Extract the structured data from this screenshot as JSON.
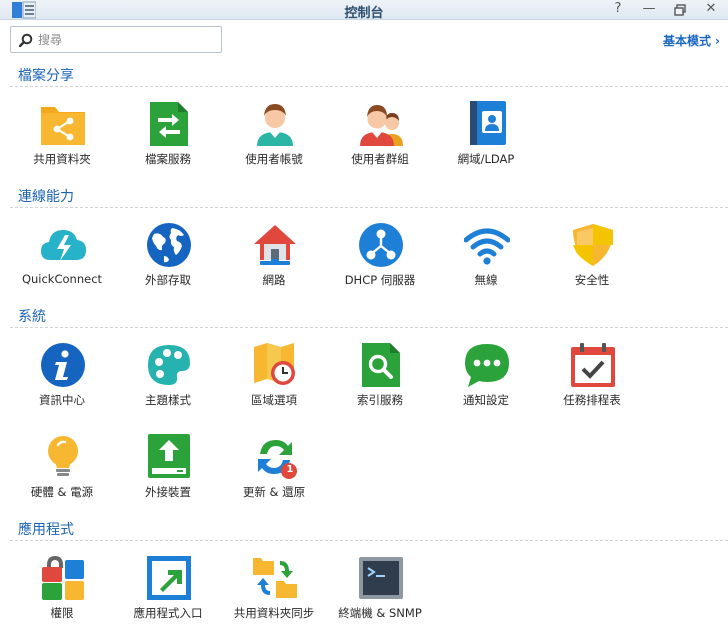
{
  "window": {
    "title": "控制台",
    "help_label": "?",
    "minimize_label": "—",
    "restore_label": "▫",
    "close_label": "✕"
  },
  "toolbar": {
    "search_placeholder": "搜尋",
    "mode_label": "基本模式",
    "mode_chevron": "›"
  },
  "sections": [
    {
      "title": "檔案分享",
      "items": [
        {
          "label": "共用資料夾",
          "icon": "shared-folder-icon"
        },
        {
          "label": "檔案服務",
          "icon": "file-services-icon"
        },
        {
          "label": "使用者帳號",
          "icon": "user-icon"
        },
        {
          "label": "使用者群組",
          "icon": "group-icon"
        },
        {
          "label": "網域/LDAP",
          "icon": "domain-ldap-icon"
        }
      ]
    },
    {
      "title": "連線能力",
      "items": [
        {
          "label": "QuickConnect",
          "icon": "quickconnect-icon"
        },
        {
          "label": "外部存取",
          "icon": "external-access-icon"
        },
        {
          "label": "網路",
          "icon": "network-icon"
        },
        {
          "label": "DHCP 伺服器",
          "icon": "dhcp-server-icon"
        },
        {
          "label": "無線",
          "icon": "wireless-icon"
        },
        {
          "label": "安全性",
          "icon": "security-icon"
        }
      ]
    },
    {
      "title": "系統",
      "items": [
        {
          "label": "資訊中心",
          "icon": "info-center-icon"
        },
        {
          "label": "主題樣式",
          "icon": "theme-palette-icon"
        },
        {
          "label": "區域選項",
          "icon": "regional-options-icon"
        },
        {
          "label": "索引服務",
          "icon": "indexing-service-icon"
        },
        {
          "label": "通知設定",
          "icon": "notification-icon"
        },
        {
          "label": "任務排程表",
          "icon": "task-scheduler-icon"
        },
        {
          "label": "硬體 & 電源",
          "icon": "hardware-power-icon"
        },
        {
          "label": "外接裝置",
          "icon": "external-devices-icon"
        },
        {
          "label": "更新 & 還原",
          "icon": "update-restore-icon",
          "badge": "1"
        }
      ]
    },
    {
      "title": "應用程式",
      "items": [
        {
          "label": "權限",
          "icon": "privileges-icon"
        },
        {
          "label": "應用程式入口",
          "icon": "application-portal-icon"
        },
        {
          "label": "共用資料夾同步",
          "icon": "shared-folder-sync-icon"
        },
        {
          "label": "終端機 & SNMP",
          "icon": "terminal-snmp-icon"
        }
      ]
    }
  ]
}
